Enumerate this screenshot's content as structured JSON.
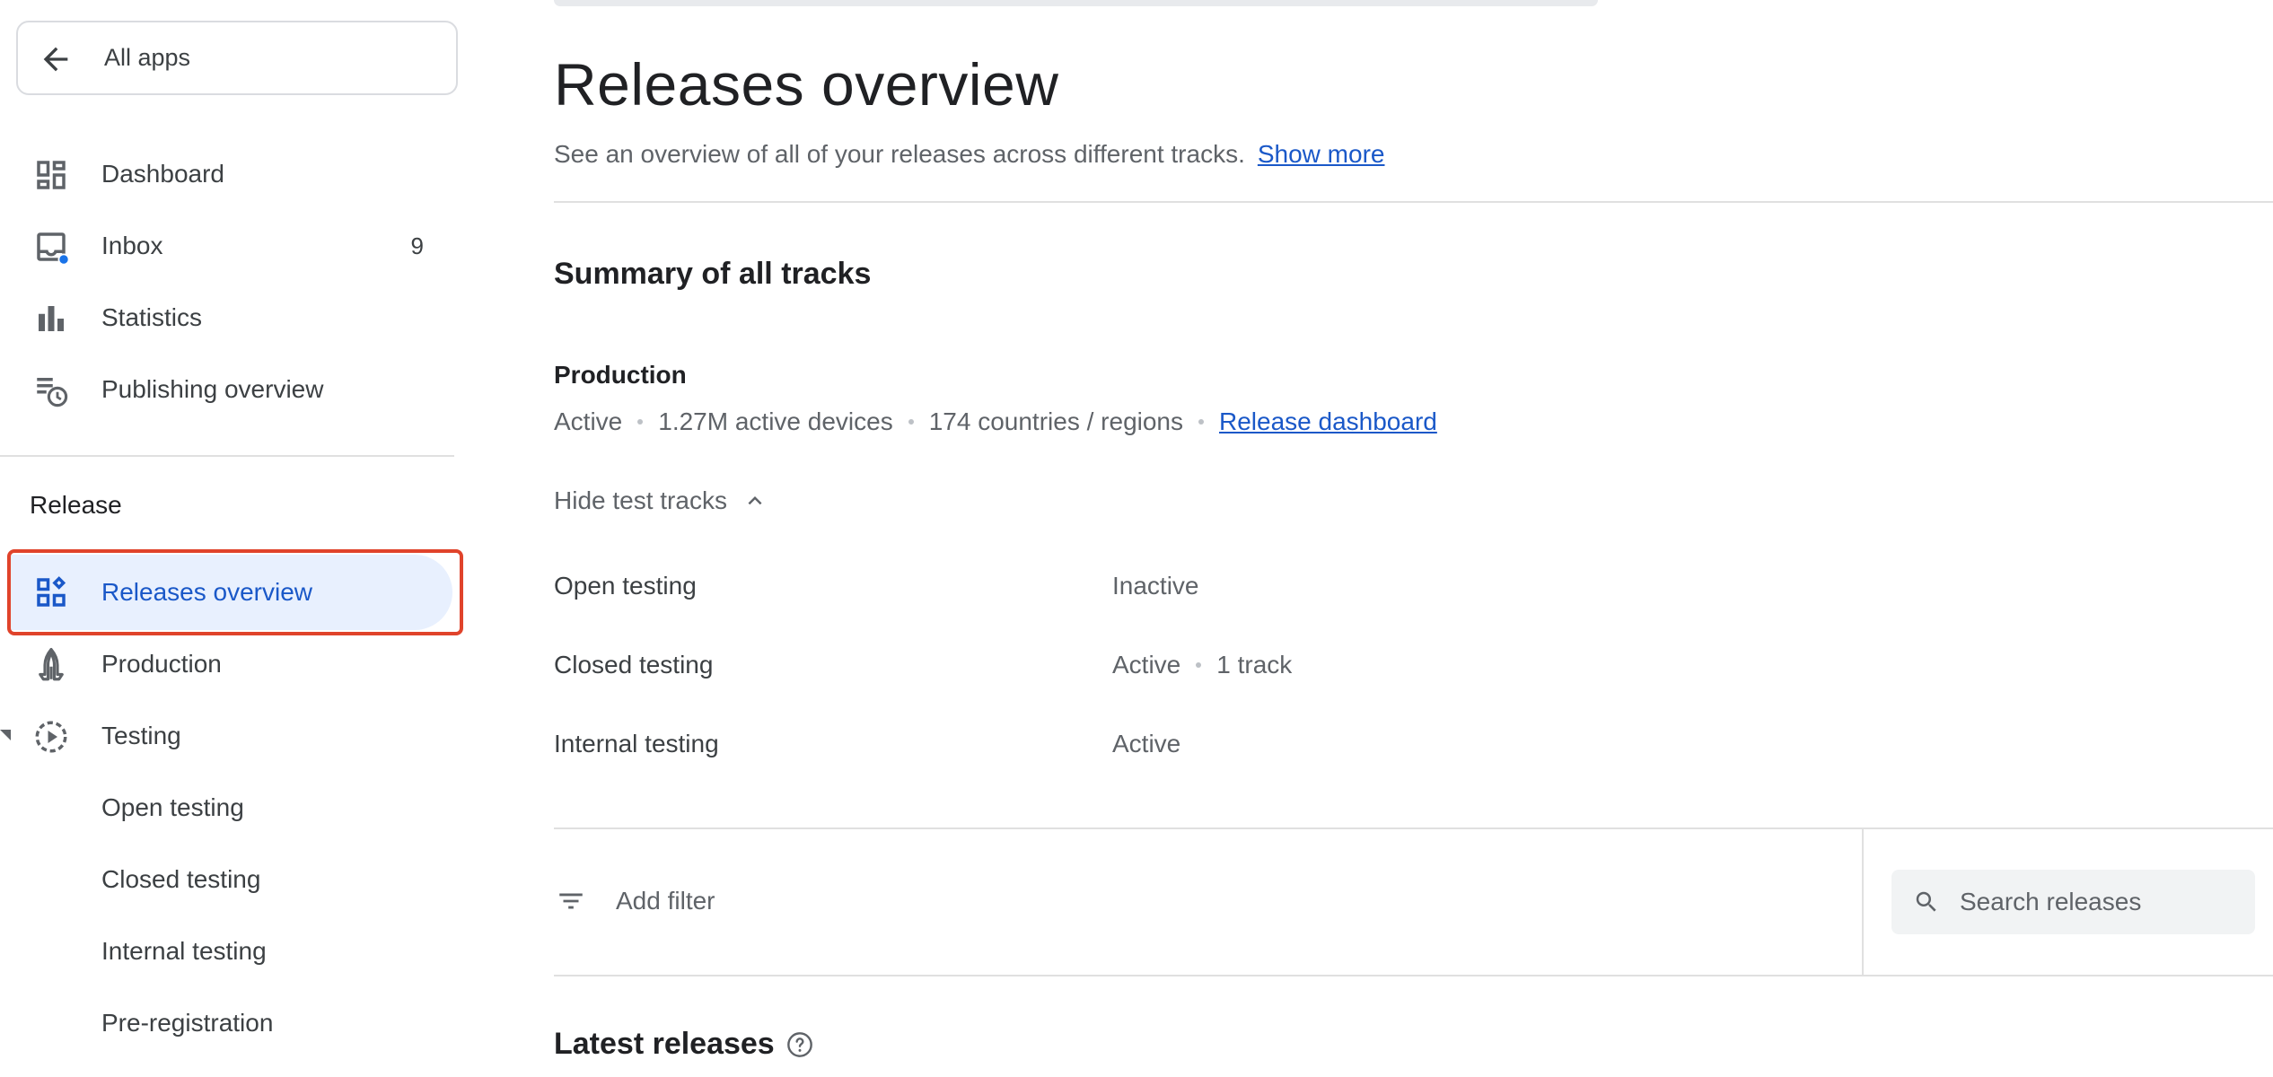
{
  "sidebar": {
    "all_apps_label": "All apps",
    "items": [
      {
        "label": "Dashboard",
        "icon": "dashboard-icon"
      },
      {
        "label": "Inbox",
        "icon": "inbox-icon",
        "count": "9"
      },
      {
        "label": "Statistics",
        "icon": "bar-chart-icon"
      },
      {
        "label": "Publishing overview",
        "icon": "publishing-overview-icon"
      }
    ],
    "section_title": "Release",
    "release_items": [
      {
        "label": "Releases overview",
        "icon": "releases-overview-icon",
        "active": true
      },
      {
        "label": "Production",
        "icon": "production-icon"
      },
      {
        "label": "Testing",
        "icon": "testing-icon"
      },
      {
        "label": "Open testing"
      },
      {
        "label": "Closed testing"
      },
      {
        "label": "Internal testing"
      },
      {
        "label": "Pre-registration"
      }
    ]
  },
  "main": {
    "title": "Releases overview",
    "subtitle": "See an overview of all of your releases across different tracks.",
    "show_more": "Show more",
    "summary_title": "Summary of all tracks",
    "production": {
      "title": "Production",
      "status": "Active",
      "devices": "1.27M active devices",
      "countries": "174 countries / regions",
      "dashboard_link": "Release dashboard"
    },
    "hide_tracks_label": "Hide test tracks",
    "tracks": [
      {
        "name": "Open testing",
        "status": "Inactive",
        "extra": ""
      },
      {
        "name": "Closed testing",
        "status": "Active",
        "extra": "1 track"
      },
      {
        "name": "Internal testing",
        "status": "Active",
        "extra": ""
      }
    ],
    "filter_label": "Add filter",
    "search_placeholder": "Search releases",
    "latest_title": "Latest releases"
  },
  "colors": {
    "accent": "#1a58c8",
    "active_bg": "#e8f0fe",
    "highlight": "#e0432b",
    "inbox_dot": "#1a73e8"
  }
}
